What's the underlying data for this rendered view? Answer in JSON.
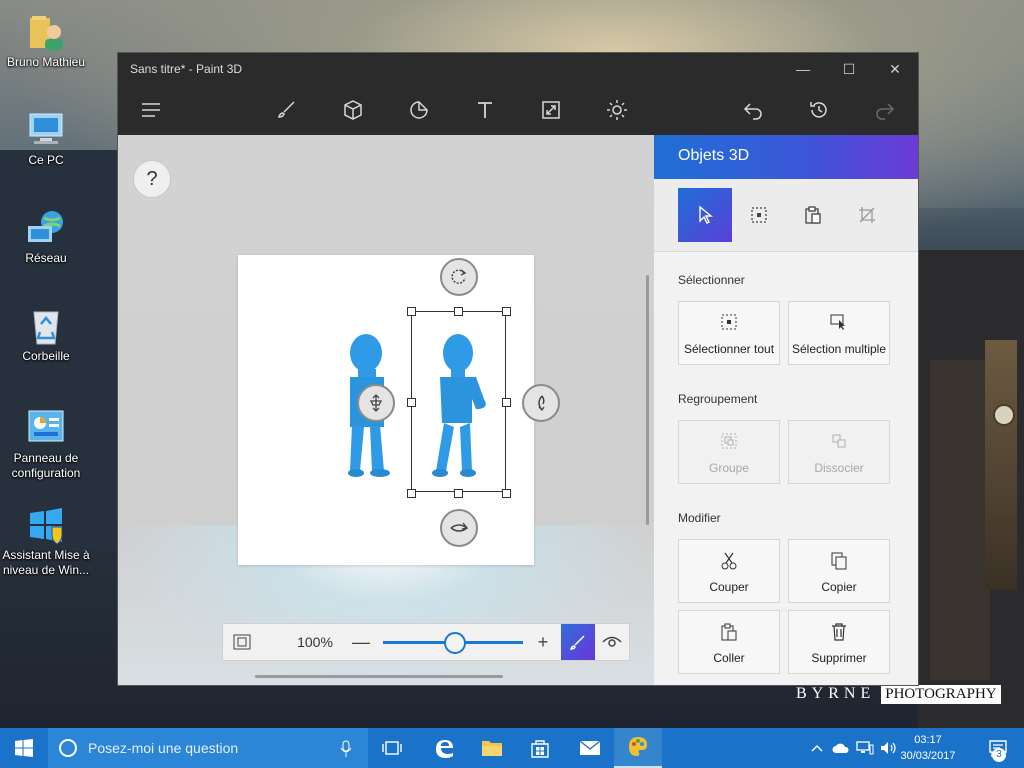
{
  "desktop": {
    "icons": [
      {
        "label": "Bruno Mathieu"
      },
      {
        "label": "Ce PC"
      },
      {
        "label": "Réseau"
      },
      {
        "label": "Corbeille"
      },
      {
        "label": "Panneau de configuration"
      },
      {
        "label": "Assistant Mise à niveau de Win..."
      }
    ],
    "watermark": {
      "brand": "BYRNE",
      "suffix": "PHOTOGRAPHY"
    }
  },
  "window": {
    "title": "Sans titre* - Paint 3D",
    "controls": {
      "minimize": "—",
      "maximize": "☐",
      "close": "✕"
    }
  },
  "canvas": {
    "help_label": "?"
  },
  "zoom": {
    "percent": "100%",
    "level": 0.5
  },
  "panel": {
    "title": "Objets 3D",
    "sections": {
      "select": "Sélectionner",
      "group": "Regroupement",
      "modify": "Modifier"
    },
    "buttons": {
      "select_all": "Sélectionner tout",
      "multi_select": "Sélection multiple",
      "group": "Groupe",
      "ungroup": "Dissocier",
      "cut": "Couper",
      "copy": "Copier",
      "paste": "Coller",
      "delete": "Supprimer"
    }
  },
  "taskbar": {
    "search_placeholder": "Posez-moi une question",
    "time": "03:17",
    "date": "30/03/2017",
    "notification_count": "3"
  }
}
